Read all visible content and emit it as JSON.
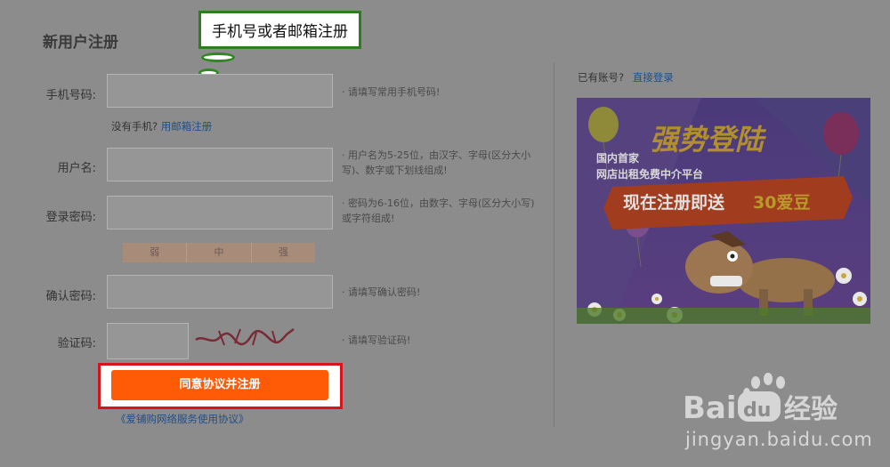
{
  "form": {
    "title": "新用户注册",
    "callout": "手机号或者邮箱注册",
    "fields": [
      {
        "label": "手机号码:",
        "tip": "· 请填写常用手机号码!"
      },
      {
        "label": "用户名:",
        "tip": "· 用户名为5-25位，由汉字、字母(区分大小写)、数字或下划线组成!"
      },
      {
        "label": "登录密码:",
        "tip": "· 密码为6-16位，由数字、字母(区分大小写)或字符组成!"
      },
      {
        "label": "确认密码:",
        "tip": "· 请填写确认密码!"
      },
      {
        "label": "验证码:",
        "tip": "· 请填写验证码!"
      }
    ],
    "no_phone_text": "没有手机?",
    "email_register_link": "用邮箱注册",
    "strength": [
      "弱",
      "中",
      "强"
    ],
    "submit_label": "同意协议并注册",
    "agreement_link": "《爱铺购网络服务使用协议》"
  },
  "side": {
    "have_account": "已有账号?",
    "login_link": "直接登录"
  },
  "promo": {
    "headline": "强势登陆",
    "line1": "国内首家",
    "line2": "网店出租免费中介平台",
    "banner": "现在注册即送",
    "banner_highlight": "30爱豆"
  },
  "watermark": {
    "brand_left": "Bai",
    "brand_paw": "du",
    "brand_right": "经验",
    "url": "jingyan.baidu.com"
  }
}
